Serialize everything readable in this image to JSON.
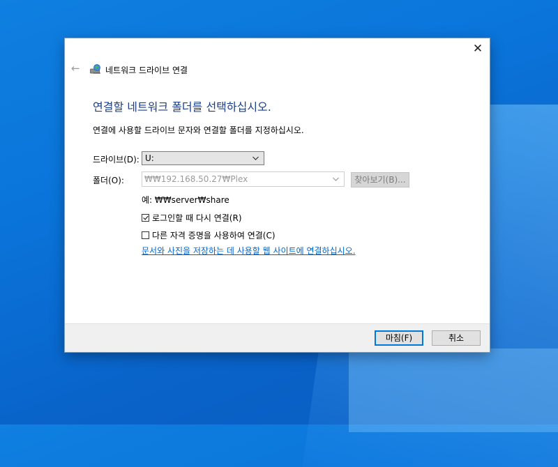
{
  "dialog": {
    "title": "네트워크 드라이브 연결",
    "close_glyph": "✕",
    "back_glyph": "←"
  },
  "heading": "연결할 네트워크 폴더를 선택하십시오.",
  "instruction": "연결에 사용할 드라이브 문자와 연결할 폴더를 지정하십시오.",
  "drive": {
    "label": "드라이브(D):",
    "value": "U:"
  },
  "folder": {
    "label": "폴더(O):",
    "value": "₩₩192.168.50.27₩Plex",
    "browse_label": "찾아보기(B)..."
  },
  "example": "예: ₩₩server₩share",
  "options": {
    "reconnect": {
      "label": "로그인할 때 다시 연결(R)",
      "checked": true
    },
    "other_credentials": {
      "label": "다른 자격 증명을 사용하여 연결(C)",
      "checked": false
    }
  },
  "link": "문서와 사진을 저장하는 데 사용할 웹 사이트에 연결하십시오.",
  "footer": {
    "finish_label": "마침(F)",
    "cancel_label": "취소"
  },
  "colors": {
    "heading": "#1a3e8a",
    "link": "#0066cc",
    "primary_border": "#0078d7",
    "desktop": "#0a74da"
  }
}
